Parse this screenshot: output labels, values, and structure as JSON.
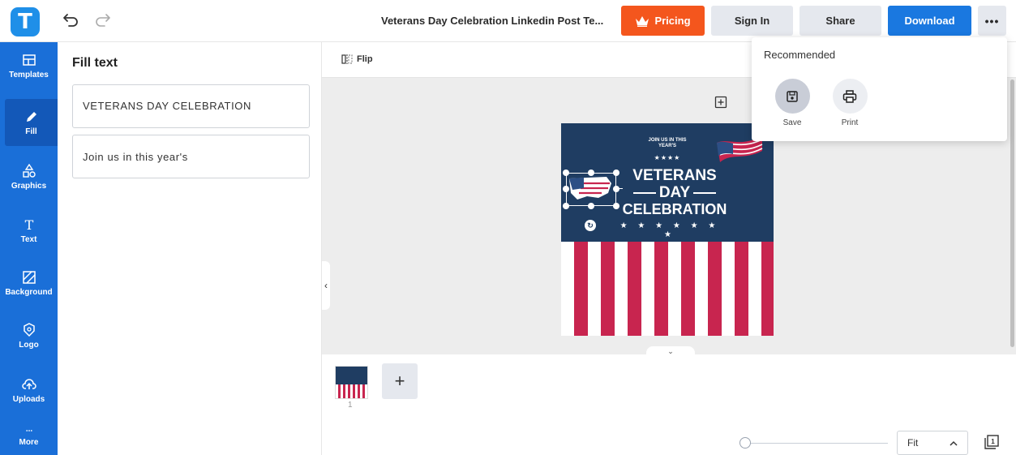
{
  "header": {
    "logo_letter": "T",
    "doc_title": "Veterans Day Celebration Linkedin Post Te...",
    "pricing_label": "Pricing",
    "signin_label": "Sign In",
    "share_label": "Share",
    "download_label": "Download",
    "more_label": "•••"
  },
  "rail": {
    "items": [
      {
        "label": "Templates",
        "icon": "templates-icon"
      },
      {
        "label": "Fill",
        "icon": "pencil-icon"
      },
      {
        "label": "Graphics",
        "icon": "shapes-icon"
      },
      {
        "label": "Text",
        "icon": "text-icon"
      },
      {
        "label": "Background",
        "icon": "background-icon"
      },
      {
        "label": "Logo",
        "icon": "logo-icon"
      },
      {
        "label": "Uploads",
        "icon": "upload-icon"
      },
      {
        "label": "More",
        "icon": "more-icon"
      }
    ],
    "active_index": 1
  },
  "panel": {
    "title": "Fill text",
    "fields": [
      {
        "value": "VETERANS DAY CELEBRATION"
      },
      {
        "value": "Join us in this year's"
      }
    ]
  },
  "toolbar": {
    "flip_label": "Flip"
  },
  "design": {
    "join_text": "JOIN US IN THIS YEAR'S",
    "small_stars": "★★★★",
    "line1": "VETERANS",
    "line2": "DAY",
    "line3": "CELEBRATION",
    "stars": "★ ★ ★ ★ ★ ★ ★",
    "rotate_glyph": "↻"
  },
  "dropdown": {
    "title": "Recommended",
    "items": [
      {
        "label": "Save",
        "icon": "save-icon"
      },
      {
        "label": "Print",
        "icon": "print-icon"
      }
    ]
  },
  "pages": {
    "thumb_number": "1",
    "add_label": "+"
  },
  "zoom": {
    "value": "Fit",
    "slider_level": 0
  },
  "colors": {
    "brand_blue": "#1a78e0",
    "rail_blue": "#1a6fd8",
    "pricing_orange": "#f4561d",
    "navy": "#1f3d62",
    "stripe_red": "#c8254f"
  }
}
